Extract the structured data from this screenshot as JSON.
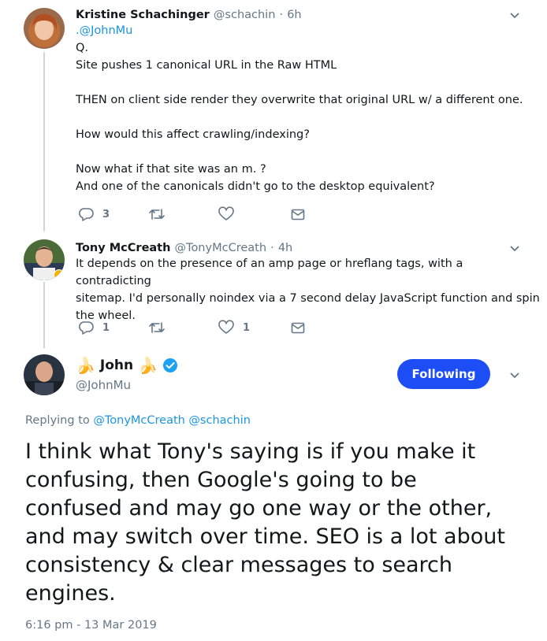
{
  "tweets": [
    {
      "name": "Kristine Schachinger",
      "handle": "@schachin",
      "time": "6h",
      "lines": [
        ".@JohnMu",
        "Q.",
        "Site pushes 1 canonical URL in the Raw HTML",
        "",
        "THEN on client side render they overwrite that original URL w/ a different one.",
        "",
        "How would this affect crawling/indexing?",
        "",
        "Now what if that site was an m. ?",
        "And one of the canonicals didn't go to the desktop equivalent?"
      ],
      "replies": "3",
      "retweets": "",
      "likes": ""
    },
    {
      "name": "Tony McCreath",
      "handle": "@TonyMcCreath",
      "time": "4h",
      "lines": [
        "It depends on the presence of an amp page or hreflang tags, with a contradicting",
        "sitemap. I'd personally noindex via a 7 second delay JavaScript function and spin",
        "the wheel."
      ],
      "replies": "1",
      "retweets": "",
      "likes": "1"
    }
  ],
  "main": {
    "name": "John",
    "name_emoji": "🍌",
    "handle": "@JohnMu",
    "follow_label": "Following",
    "replying_prefix": "Replying to",
    "replying_to": "@TonyMcCreath @schachin",
    "text_lines": [
      "I think what Tony's saying is if you make it",
      "confusing, then Google's going to be",
      "confused and may go one way or the other,",
      "and may switch over time. SEO is a lot about",
      "consistency & clear messages to search",
      "engines."
    ],
    "timestamp": "6:16 pm - 13 Mar 2019"
  },
  "colors": {
    "accent": "#1d4ef5",
    "link": "#1b95e0",
    "muted": "#657786",
    "thread_line": "#ccd6dd"
  },
  "icons": [
    "reply-icon",
    "retweet-icon",
    "like-icon",
    "dm-icon",
    "chevron-down-icon",
    "verified-badge-icon"
  ]
}
